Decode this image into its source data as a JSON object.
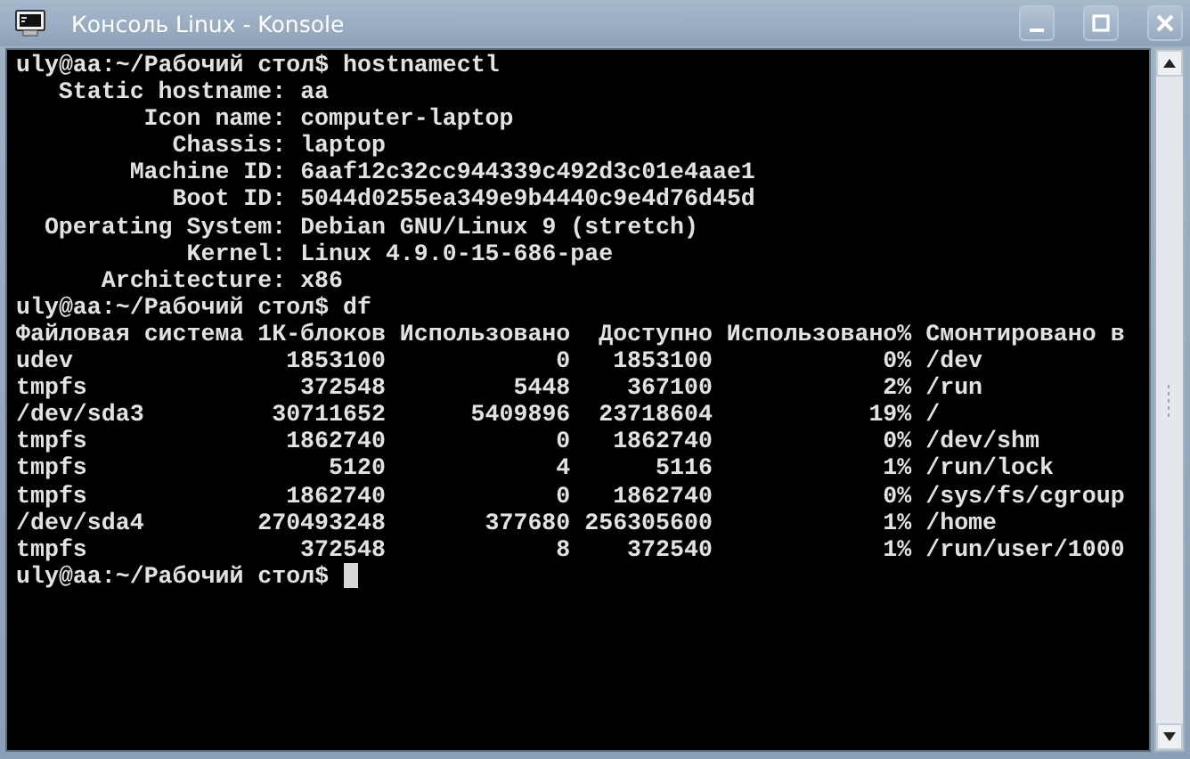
{
  "window": {
    "title": "Консоль Linux - Konsole"
  },
  "terminal": {
    "blocks": [
      {
        "kind": "prompt",
        "text": "uly@aa:~/Рабочий стол$ hostnamectl"
      },
      {
        "kind": "keyvalue",
        "rows": [
          {
            "key": "Static hostname:",
            "value": "aa"
          },
          {
            "key": "Icon name:",
            "value": "computer-laptop"
          },
          {
            "key": "Chassis:",
            "value": "laptop"
          },
          {
            "key": "Machine ID:",
            "value": "6aaf12c32cc944339c492d3c01e4aae1"
          },
          {
            "key": "Boot ID:",
            "value": "5044d0255ea349e9b4440c9e4d76d45d"
          },
          {
            "key": "Operating System:",
            "value": "Debian GNU/Linux 9 (stretch)"
          },
          {
            "key": "Kernel:",
            "value": "Linux 4.9.0-15-686-pae"
          },
          {
            "key": "Architecture:",
            "value": "x86"
          }
        ]
      },
      {
        "kind": "prompt",
        "text": "uly@aa:~/Рабочий стол$ df"
      },
      {
        "kind": "table",
        "columns": [
          "Файловая система",
          "1К-блоков",
          "Использовано",
          "Доступно",
          "Использовано%",
          "Смонтировано в"
        ],
        "rows": [
          [
            "udev",
            "1853100",
            "0",
            "1853100",
            "0%",
            "/dev"
          ],
          [
            "tmpfs",
            "372548",
            "5448",
            "367100",
            "2%",
            "/run"
          ],
          [
            "/dev/sda3",
            "30711652",
            "5409896",
            "23718604",
            "19%",
            "/"
          ],
          [
            "tmpfs",
            "1862740",
            "0",
            "1862740",
            "0%",
            "/dev/shm"
          ],
          [
            "tmpfs",
            "5120",
            "4",
            "5116",
            "1%",
            "/run/lock"
          ],
          [
            "tmpfs",
            "1862740",
            "0",
            "1862740",
            "0%",
            "/sys/fs/cgroup"
          ],
          [
            "/dev/sda4",
            "270493248",
            "377680",
            "256305600",
            "1%",
            "/home"
          ],
          [
            "tmpfs",
            "372548",
            "8",
            "372540",
            "1%",
            "/run/user/1000"
          ]
        ]
      },
      {
        "kind": "prompt",
        "text": "uly@aa:~/Рабочий стол$",
        "cursor": true
      }
    ]
  }
}
